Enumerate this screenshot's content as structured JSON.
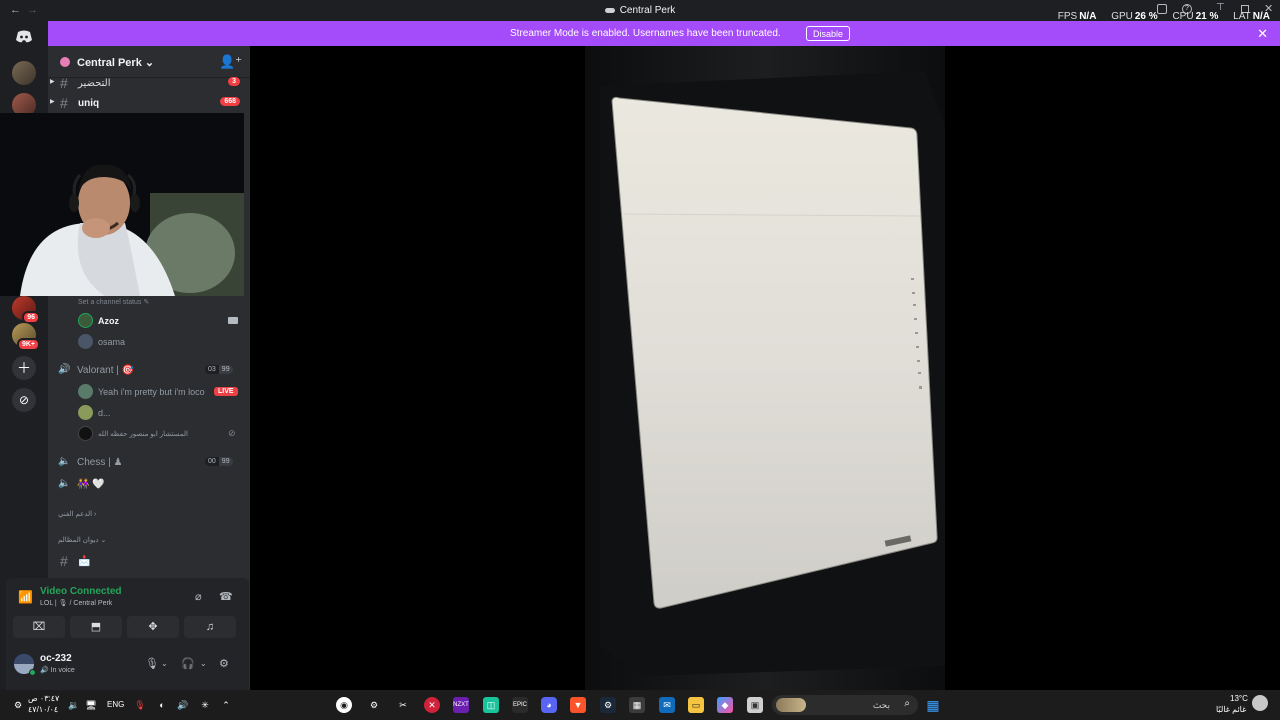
{
  "titlebar": {
    "back": "←",
    "forward": "→",
    "title": "Central Perk"
  },
  "stats": {
    "fps_label": "FPS",
    "fps": "N/A",
    "gpu_label": "GPU",
    "gpu": "26 %",
    "cpu_label": "CPU",
    "cpu": "21 %",
    "lat_label": "LAT",
    "lat": "N/A"
  },
  "banner": {
    "message": "Streamer Mode is enabled. Usernames have been truncated.",
    "button": "Disable",
    "close": "✕"
  },
  "server": {
    "name": "Central Perk",
    "caret": "⌄"
  },
  "channels": [
    {
      "label": "التحضير",
      "badge": "3"
    },
    {
      "label": "uniq",
      "badge": "668"
    }
  ],
  "channel_status": "Set a channel status ✎",
  "members_top": [
    {
      "name": "Azoz"
    },
    {
      "name": "osama"
    }
  ],
  "voice_channels": {
    "valorant": {
      "label": "Valorant | 🎯",
      "count_a": "03",
      "count_b": "99"
    },
    "chess": {
      "label": "Chess | ♟",
      "count_a": "00",
      "count_b": "99"
    },
    "hearts": {
      "label": "👭 🤍"
    }
  },
  "valorant_members": [
    {
      "name": "Yeah i'm pretty but i'm loco",
      "live": "LIVE"
    },
    {
      "name": "d..."
    },
    {
      "name": "المستشار ابو منصور حفظه الله"
    }
  ],
  "categories": {
    "support": "الدعم الفني ›",
    "complaints": "ديوان المظالم ⌄"
  },
  "last_channel": {
    "label": "📩"
  },
  "voice_panel": {
    "title": "Video Connected",
    "subtitle": "LOL | 🎙 / Central Perk"
  },
  "user": {
    "name": "oc-232",
    "status": "In voice"
  },
  "server_badges": {
    "first": "96",
    "second": "9K+"
  },
  "taskbar": {
    "time": "٠٣:٤٧ ص",
    "date": "٤٧/١٠/٠٤",
    "lang": "ENG",
    "search_placeholder": "بحث",
    "temp": "13°C",
    "weather": "غائم غالبًا"
  }
}
